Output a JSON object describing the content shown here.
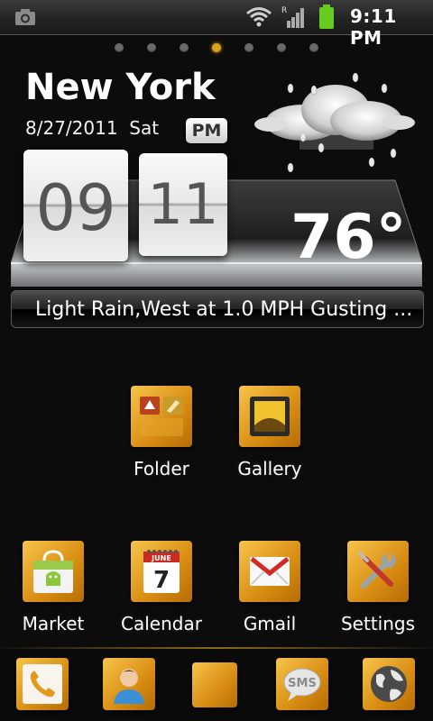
{
  "status_bar": {
    "time": "9:11 PM",
    "signal_label": "R",
    "battery_color": "#66cc22"
  },
  "home_pages": {
    "count": 7,
    "active_index": 3,
    "active_color": "#d8a21a"
  },
  "weather_widget": {
    "city": "New York",
    "date": "8/27/2011  Sat",
    "ampm": "PM",
    "hour": "09",
    "minute": "11",
    "temperature": "76°",
    "condition": "Light Rain,West at 1.0 MPH Gusting ...",
    "weather_icon": "rain-cloud-icon"
  },
  "apps": [
    {
      "label": "Folder",
      "icon": "folder-icon"
    },
    {
      "label": "Gallery",
      "icon": "gallery-icon"
    },
    {
      "label": "Market",
      "icon": "market-icon"
    },
    {
      "label": "Calendar",
      "icon": "calendar-icon",
      "calendar_month": "JUNE",
      "calendar_day": "7"
    },
    {
      "label": "Gmail",
      "icon": "gmail-icon"
    },
    {
      "label": "Settings",
      "icon": "settings-icon"
    }
  ],
  "dock": [
    {
      "icon": "phone-icon"
    },
    {
      "icon": "contacts-icon"
    },
    {
      "icon": "app-drawer-icon"
    },
    {
      "icon": "sms-icon",
      "text": "SMS"
    },
    {
      "icon": "browser-icon"
    }
  ],
  "accent_color": "#e0a020"
}
